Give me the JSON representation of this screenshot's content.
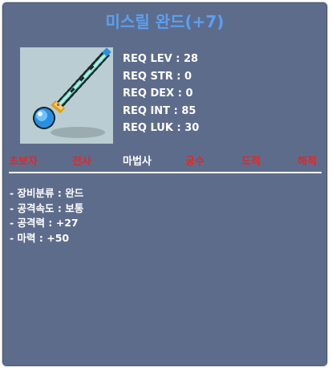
{
  "item": {
    "name": "미스릴 완드(+7)",
    "icon": "wand-icon",
    "requirements": [
      {
        "label": "REQ LEV",
        "value": "28"
      },
      {
        "label": "REQ STR",
        "value": "0"
      },
      {
        "label": "REQ DEX",
        "value": "0"
      },
      {
        "label": "REQ INT",
        "value": "85"
      },
      {
        "label": "REQ LUK",
        "value": "30"
      }
    ],
    "classes": [
      {
        "label": "초보자",
        "color": "#e02828"
      },
      {
        "label": "전사",
        "color": "#e02828"
      },
      {
        "label": "마법사",
        "color": "#ffffff"
      },
      {
        "label": "궁수",
        "color": "#e02828"
      },
      {
        "label": "도적",
        "color": "#e02828"
      },
      {
        "label": "해적",
        "color": "#e02828"
      }
    ],
    "details": [
      {
        "label": "- 장비분류",
        "value": "완드"
      },
      {
        "label": "- 공격속도",
        "value": "보통"
      },
      {
        "label": "- 공격력",
        "value": "+27"
      },
      {
        "label": "- 마력",
        "value": "+50"
      }
    ]
  },
  "colors": {
    "title": "#5aa0f0",
    "panel_bg": "#5e6c8c",
    "icon_bg": "#b9cdd3",
    "unavailable_class": "#e02828",
    "available_class": "#ffffff"
  }
}
